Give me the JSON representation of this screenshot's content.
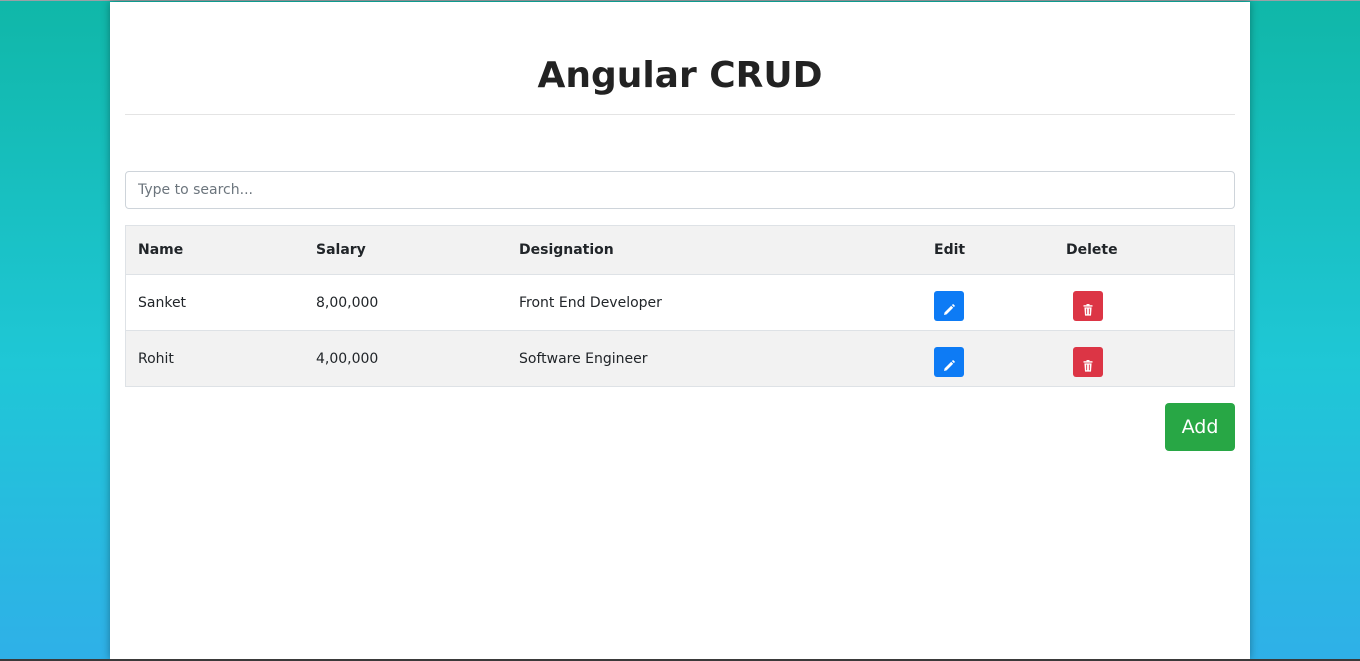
{
  "app": {
    "title": "Angular CRUD"
  },
  "search": {
    "placeholder": "Type to search...",
    "value": ""
  },
  "table": {
    "headers": {
      "name": "Name",
      "salary": "Salary",
      "designation": "Designation",
      "edit": "Edit",
      "delete": "Delete"
    },
    "rows": [
      {
        "name": "Sanket",
        "salary": "8,00,000",
        "designation": "Front End Developer"
      },
      {
        "name": "Rohit",
        "salary": "4,00,000",
        "designation": "Software Engineer"
      }
    ]
  },
  "actions": {
    "add_label": "Add",
    "edit_icon": "pencil-icon",
    "delete_icon": "trash-icon"
  },
  "colors": {
    "edit_button": "#0d7bf5",
    "delete_button": "#dc3545",
    "add_button": "#28a745",
    "background_top": "#10b7a8",
    "background_bottom": "#2fb0e8"
  }
}
